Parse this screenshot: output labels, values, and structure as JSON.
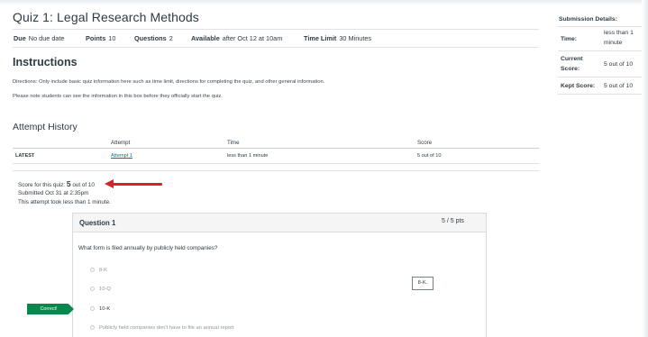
{
  "quiz": {
    "title": "Quiz 1: Legal Research Methods",
    "meta": [
      {
        "label": "Due",
        "value": "No due date"
      },
      {
        "label": "Points",
        "value": "10"
      },
      {
        "label": "Questions",
        "value": "2"
      },
      {
        "label": "Available",
        "value": "after Oct 12 at 10am"
      },
      {
        "label": "Time Limit",
        "value": "30 Minutes"
      }
    ]
  },
  "instructions": {
    "heading": "Instructions",
    "lines": [
      "Directions: Only include basic quiz information here such as time limit, directions for completing the quiz, and other general information.",
      "Please note students can see the information in this box before they officially start the quiz."
    ]
  },
  "attempt_history": {
    "heading": "Attempt History",
    "columns": [
      "",
      "Attempt",
      "Time",
      "Score"
    ],
    "rows": [
      {
        "tag": "LATEST",
        "attempt": "Attempt 1",
        "time": "less than 1 minute",
        "score": "5 out of 10"
      }
    ]
  },
  "result": {
    "prefix": "Score for this quiz: ",
    "score": "5",
    "suffix": " out of 10",
    "submitted": "Submitted Oct 31 at 2:35pm",
    "duration": "This attempt took less than 1 minute."
  },
  "question": {
    "title": "Question 1",
    "points": "5 / 5 pts",
    "text": "What form is filed annually by publicly held companies?",
    "answers": [
      {
        "label": "8-K",
        "selected": false
      },
      {
        "label": "10-Q",
        "selected": false
      },
      {
        "label": "10-K",
        "selected": true
      },
      {
        "label": "Publicly held companies don't have to file an annual report",
        "selected": false
      }
    ],
    "correct_answer_box": "8-K.",
    "correct_tag": "Correct!"
  },
  "submission": {
    "title": "Submission Details:",
    "rows": [
      {
        "label": "Time:",
        "value_lines": [
          "less than 1",
          "minute"
        ]
      },
      {
        "label_lines": [
          "Current",
          "Score:"
        ],
        "value": "5 out of 10"
      },
      {
        "label": "Kept Score:",
        "value": "5 out of 10"
      }
    ]
  },
  "colors": {
    "accent": "#d0262b",
    "correct": "#0b874b",
    "link": "#0770a3"
  }
}
